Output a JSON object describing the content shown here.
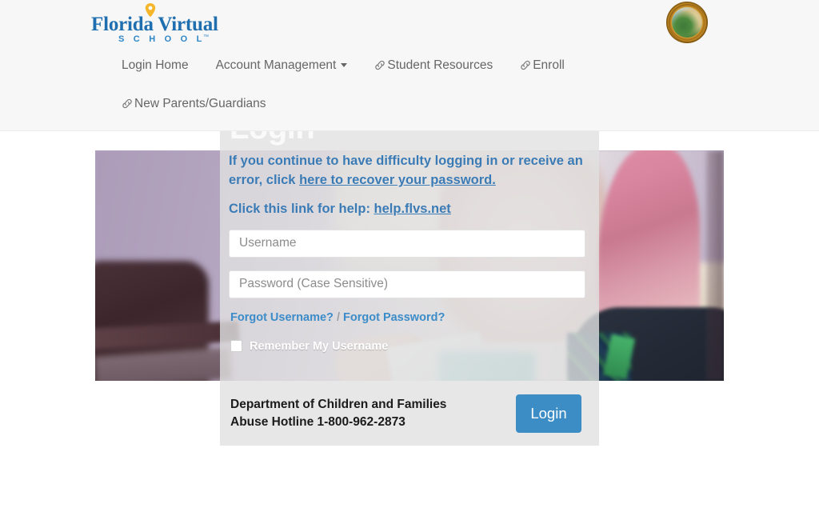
{
  "header": {
    "logo": {
      "name": "Florida Virtual",
      "subtitle": "S C H O O L",
      "trademark": "™",
      "pin_icon": "location-pin-icon"
    },
    "seal": {
      "icon": "florida-state-seal-icon"
    },
    "nav": {
      "row1": [
        {
          "label": "Login Home",
          "icon": null,
          "caret": false
        },
        {
          "label": "Account Management",
          "icon": null,
          "caret": true
        },
        {
          "label": "Student Resources",
          "icon": "link-icon",
          "caret": false
        },
        {
          "label": "Enroll",
          "icon": "link-icon",
          "caret": false
        }
      ],
      "row2": [
        {
          "label": "New Parents/Guardians",
          "icon": "link-icon",
          "caret": false
        }
      ]
    }
  },
  "login_panel": {
    "title": "Login",
    "help_message_prefix": "If you continue to have difficulty logging in or receive an error, click ",
    "help_message_link": "here to recover your password.",
    "help_link_prefix": "Click this link for help: ",
    "help_link_text": "help.flvs.net",
    "username": {
      "placeholder": "Username",
      "value": ""
    },
    "password": {
      "placeholder": "Password (Case Sensitive)",
      "value": ""
    },
    "forgot_username": "Forgot Username?",
    "forgot_separator": " / ",
    "forgot_password": "Forgot Password?",
    "remember_label": "Remember My Username",
    "remember_checked": false,
    "footer_line1": "Department of Children and Families",
    "footer_line2": "Abuse Hotline 1-800-962-2873",
    "login_button": "Login"
  },
  "colors": {
    "logo_blue": "#1f6fb0",
    "link_blue": "#3b8cc9",
    "help_blue": "#3b7bb5",
    "button_blue": "#3c8dc5",
    "header_bg": "#f7f7f7",
    "panel_bg": "#e1e1e1",
    "nav_text": "#666666"
  }
}
